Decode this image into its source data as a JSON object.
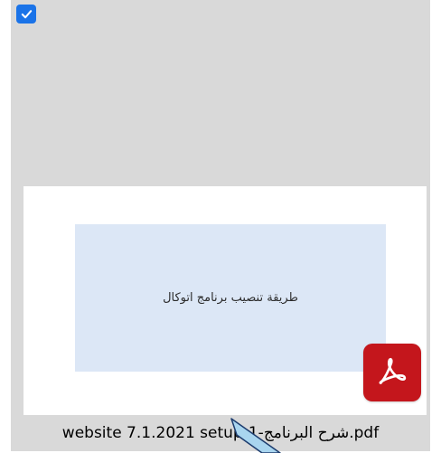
{
  "file": {
    "name": "website 7.1.2021 setup-1-شرح البرنامج.pdf",
    "selected": true,
    "preview_text": "طريقة تنصيب برنامج اتوكال",
    "type_icon": "adobe-acrobat-pdf-icon"
  },
  "colors": {
    "tile_bg": "#d9d9d9",
    "checkbox": "#1a73e8",
    "thumb_bg": "#dce7f6",
    "acrobat_red": "#c4161c",
    "cursor_fill": "#a9d5ef"
  }
}
